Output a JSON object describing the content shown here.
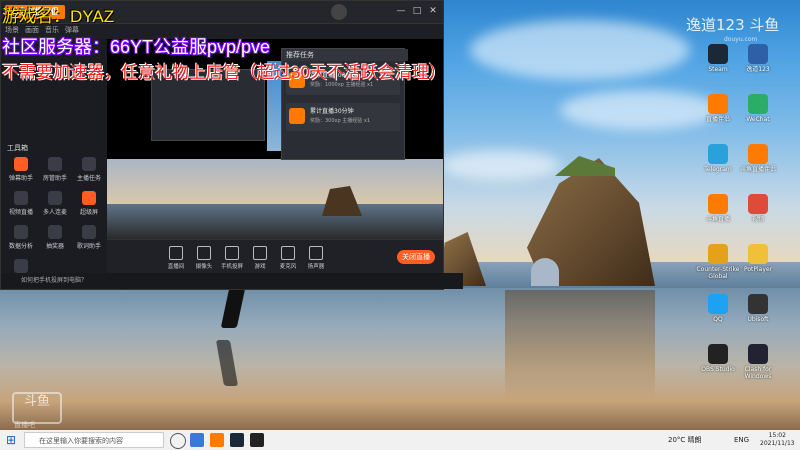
{
  "overlay": {
    "line1": "游戏名：DYAZ",
    "line2": "社区服务器：66YT公益服pvp/pve",
    "line3": "不需要加速器，任意礼物上店管（超过30天不活跃会清理）"
  },
  "watermark": {
    "text": "逸道123 斗鱼",
    "sub": "douyu.com",
    "logo": "斗鱼",
    "logo_sub": "直播吧"
  },
  "app": {
    "logo": "斗鱼直播伴侣",
    "menus": [
      "场景",
      "画面",
      "音乐",
      "弹幕"
    ],
    "window_controls": [
      "—",
      "□",
      "✕"
    ],
    "sidebar_title": "工具箱",
    "tools": [
      {
        "label": "弹幕助手",
        "color": "#ff5d23"
      },
      {
        "label": "房管助手",
        "color": "#3a3d45"
      },
      {
        "label": "主播任务",
        "color": "#3a3d45"
      },
      {
        "label": "视频直播",
        "color": "#3a3d45"
      },
      {
        "label": "多人连麦",
        "color": "#3a3d45"
      },
      {
        "label": "超级屏",
        "color": "#ff5d23"
      },
      {
        "label": "数据分析",
        "color": "#3a3d45"
      },
      {
        "label": "抽奖器",
        "color": "#3a3d45"
      },
      {
        "label": "歌词助手",
        "color": "#3a3d45"
      },
      {
        "label": "PK",
        "color": "#3a3d45"
      }
    ],
    "task_panel_title": "推荐任务",
    "tasks": [
      {
        "title": "连续直播100分钟",
        "reward": "奖励：1000xp 主播经验 x1"
      },
      {
        "title": "累计直播30分钟",
        "reward": "奖励：300xp 主播经验 x1"
      }
    ],
    "controls": [
      "直播间",
      "摄像头",
      "手机投屏",
      "游戏",
      "麦克风",
      "扬声器"
    ],
    "live_button": "关闭直播",
    "status": "如何把手机投屏到电脑？"
  },
  "desktop_icons": [
    {
      "label": "Steam",
      "color": "#1b2838"
    },
    {
      "label": "逸道123",
      "color": "#2f5fa7"
    },
    {
      "label": "直播伴侣",
      "color": "#ff7a00"
    },
    {
      "label": "WeChat",
      "color": "#2aae67"
    },
    {
      "label": "Telegram",
      "color": "#2aa1da"
    },
    {
      "label": "斗鱼直播伴侣",
      "color": "#ff7a00"
    },
    {
      "label": "斗鱼直播",
      "color": "#ff7a00"
    },
    {
      "label": "视频",
      "color": "#e04a3a"
    },
    {
      "label": "Counter-Strike Global",
      "color": "#e3a21a"
    },
    {
      "label": "PotPlayer",
      "color": "#f0c03a"
    },
    {
      "label": "QQ",
      "color": "#1da1f2"
    },
    {
      "label": "Ubisoft",
      "color": "#333"
    },
    {
      "label": "OBS Studio",
      "color": "#222"
    },
    {
      "label": "Clash for Windows",
      "color": "#223"
    }
  ],
  "taskbar": {
    "search_placeholder": "在这里输入你要搜索的内容",
    "weather": "20°C 晴朗",
    "lang": "ENG",
    "time": "15:02",
    "date": "2021/11/13"
  }
}
